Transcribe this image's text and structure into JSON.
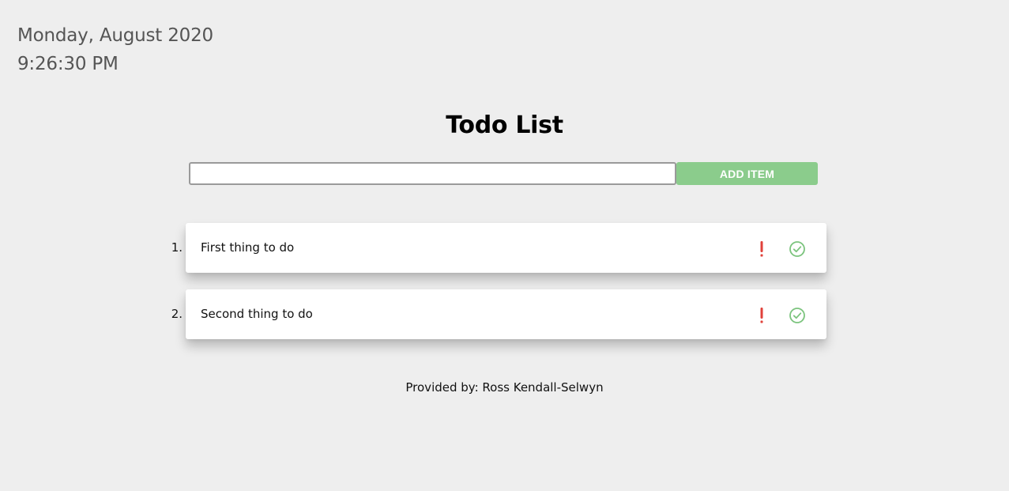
{
  "clock": {
    "date": "Monday, August 2020",
    "time": "9:26:30 PM"
  },
  "header": {
    "title": "Todo List"
  },
  "add_form": {
    "input_value": "",
    "input_placeholder": "",
    "button_label": "ADD ITEM",
    "button_color": "#8bcc8c"
  },
  "todos": [
    {
      "number": "1.",
      "text": "First thing to do",
      "priority_icon": "exclamation-icon",
      "complete_icon": "check-circle-icon"
    },
    {
      "number": "2.",
      "text": "Second thing to do",
      "priority_icon": "exclamation-icon",
      "complete_icon": "check-circle-icon"
    }
  ],
  "colors": {
    "background": "#eeeeee",
    "priority": "#e0413a",
    "complete": "#7cc47e"
  },
  "footer": {
    "credit": "Provided by: Ross Kendall-Selwyn"
  }
}
